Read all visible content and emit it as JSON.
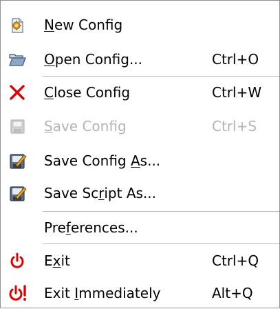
{
  "menu": {
    "items": [
      {
        "id": "new-config",
        "pre": "",
        "mnemonic": "N",
        "post": "ew Config",
        "shortcut": "",
        "icon": "new-config-icon",
        "enabled": true
      },
      {
        "id": "open-config",
        "pre": "",
        "mnemonic": "O",
        "post": "pen Config...",
        "shortcut": "Ctrl+O",
        "icon": "folder-open-icon",
        "enabled": true
      },
      {
        "id": "close-config",
        "pre": "",
        "mnemonic": "C",
        "post": "lose Config",
        "shortcut": "Ctrl+W",
        "icon": "close-x-icon",
        "enabled": true
      },
      {
        "id": "save-config",
        "pre": "",
        "mnemonic": "S",
        "post": "ave Config",
        "shortcut": "Ctrl+S",
        "icon": "save-disk-icon",
        "enabled": false
      },
      {
        "id": "save-config-as",
        "pre": "Save Config ",
        "mnemonic": "A",
        "post": "s...",
        "shortcut": "",
        "icon": "save-as-icon",
        "enabled": true
      },
      {
        "id": "save-script-as",
        "pre": "Save Sc",
        "mnemonic": "r",
        "post": "ipt As...",
        "shortcut": "",
        "icon": "save-as-icon",
        "enabled": true
      },
      {
        "id": "preferences",
        "pre": "Pre",
        "mnemonic": "f",
        "post": "erences...",
        "shortcut": "",
        "icon": "",
        "enabled": true
      },
      {
        "id": "exit",
        "pre": "E",
        "mnemonic": "x",
        "post": "it",
        "shortcut": "Ctrl+Q",
        "icon": "power-icon",
        "enabled": true
      },
      {
        "id": "exit-immediately",
        "pre": "Exit ",
        "mnemonic": "I",
        "post": "mmediately",
        "shortcut": "Alt+Q",
        "icon": "power-exclaim-icon",
        "enabled": true
      }
    ]
  },
  "colors": {
    "border": "#8f8f8f",
    "separator": "#b9b9b9",
    "disabled_text": "#b4b4b4",
    "close_red": "#d90000",
    "power_red": "#e10000"
  }
}
